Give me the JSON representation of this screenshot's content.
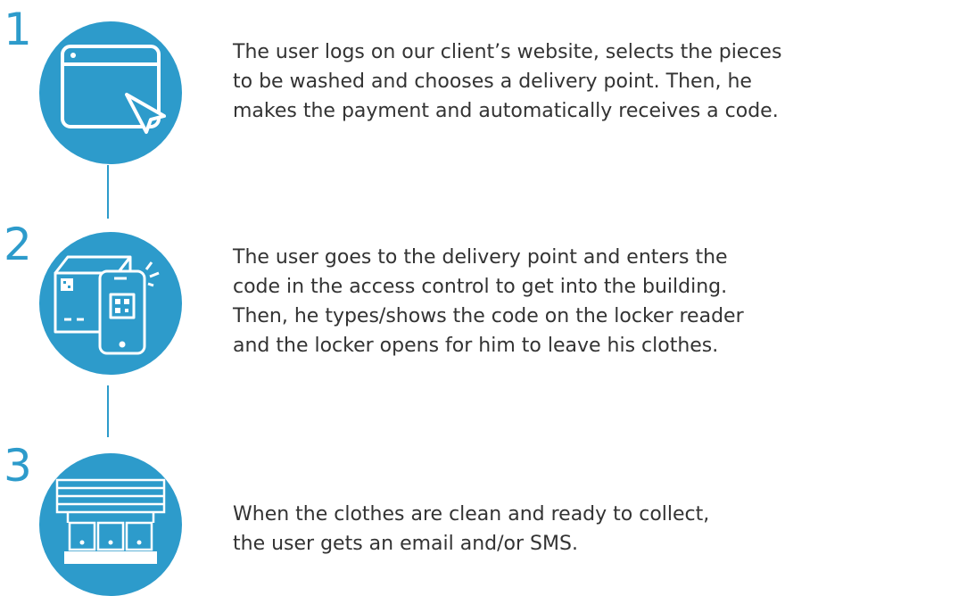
{
  "colors": {
    "accent": "#2d9bcb",
    "text": "#333333",
    "background": "#ffffff"
  },
  "steps": [
    {
      "number": "1",
      "icon": "browser-cursor-icon",
      "lines": [
        "The user logs on our client’s website, selects the pieces",
        "to be washed and chooses a delivery point. Then, he",
        "makes the payment and automatically receives a code."
      ]
    },
    {
      "number": "2",
      "icon": "package-phone-qr-icon",
      "lines": [
        "The user goes to the delivery point and enters the",
        "code in the access control to get into the building.",
        "Then, he types/shows the code on the locker reader",
        "and the locker opens for him to leave his clothes."
      ]
    },
    {
      "number": "3",
      "icon": "locker-icon",
      "lines": [
        "When the clothes are clean and ready to collect,",
        "the user gets an email and/or SMS."
      ]
    }
  ]
}
